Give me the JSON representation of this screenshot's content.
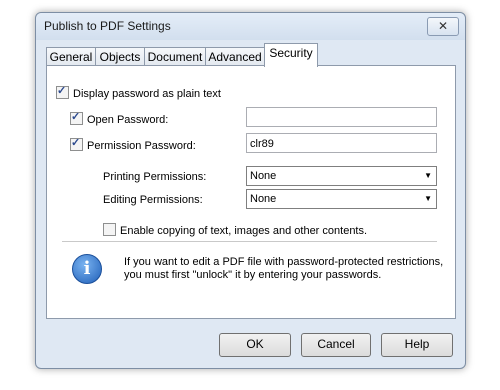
{
  "window": {
    "title": "Publish to PDF Settings",
    "close_symbol": "✕"
  },
  "tabs": [
    {
      "label": "General"
    },
    {
      "label": "Objects"
    },
    {
      "label": "Document"
    },
    {
      "label": "Advanced"
    },
    {
      "label": "Security",
      "active": true
    }
  ],
  "security": {
    "display_plain_label": "Display password as plain text",
    "display_plain_checked": true,
    "open_password_label": "Open Password:",
    "open_password_checked": true,
    "open_password_value": "",
    "permission_password_label": "Permission Password:",
    "permission_password_checked": true,
    "permission_password_value": "clr89",
    "printing_label": "Printing Permissions:",
    "printing_value": "None",
    "editing_label": "Editing Permissions:",
    "editing_value": "None",
    "enable_copying_label": "Enable copying of text, images and other contents.",
    "enable_copying_checked": false,
    "info_line1": "If you want to edit a PDF file with password-protected restrictions,",
    "info_line2": "you must first \"unlock\" it by entering your passwords."
  },
  "buttons": {
    "ok": "OK",
    "cancel": "Cancel",
    "help": "Help"
  },
  "icons": {
    "info": "info-icon",
    "close": "close-icon",
    "dropdown": "chevron-down-icon"
  }
}
